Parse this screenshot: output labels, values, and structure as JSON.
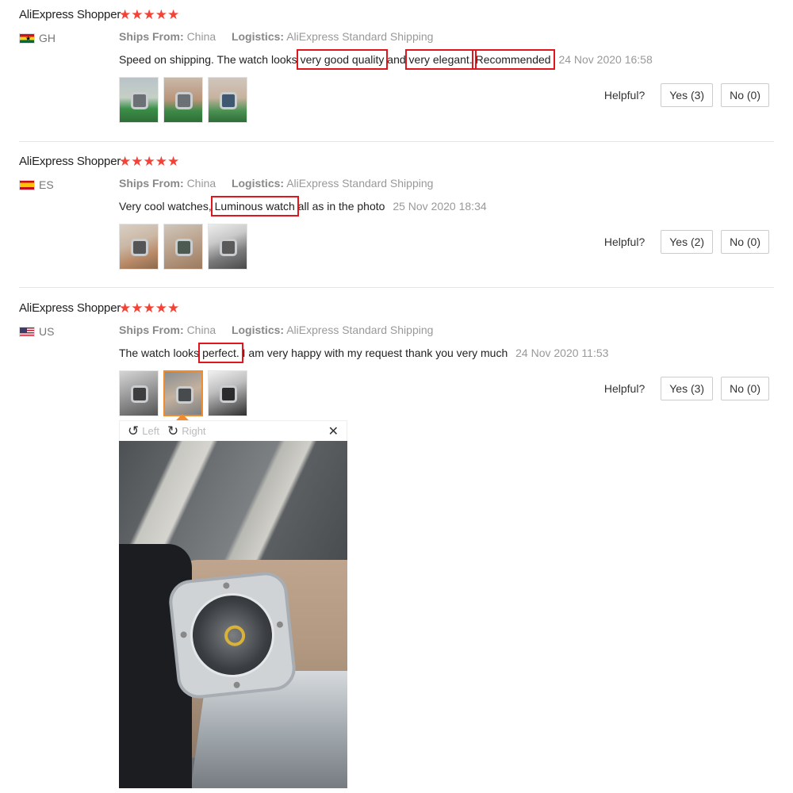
{
  "reviews": [
    {
      "name": "AliExpress Shopper",
      "stars": "★★★★★",
      "rating": 5,
      "country_code": "GH",
      "ships_from_label": "Ships From:",
      "ships_from_value": "China",
      "logistics_label": "Logistics:",
      "logistics_value": "AliExpress Standard Shipping",
      "text_parts": [
        "Speed on shipping. The watch looks ",
        "very good quality",
        " and ",
        "very elegant.",
        " ",
        "Recommended"
      ],
      "date": "24 Nov 2020 16:58",
      "thumbnail_count": 3,
      "helpful_label": "Helpful?",
      "yes_label": "Yes (3)",
      "no_label": "No (0)"
    },
    {
      "name": "AliExpress Shopper",
      "stars": "★★★★★",
      "rating": 5,
      "country_code": "ES",
      "ships_from_label": "Ships From:",
      "ships_from_value": "China",
      "logistics_label": "Logistics:",
      "logistics_value": "AliExpress Standard Shipping",
      "text_parts": [
        "Very cool watches, ",
        "Luminous watch",
        " all as in the photo"
      ],
      "date": "25 Nov 2020 18:34",
      "thumbnail_count": 3,
      "helpful_label": "Helpful?",
      "yes_label": "Yes (2)",
      "no_label": "No (0)"
    },
    {
      "name": "AliExpress Shopper",
      "stars": "★★★★★",
      "rating": 5,
      "country_code": "US",
      "ships_from_label": "Ships From:",
      "ships_from_value": "China",
      "logistics_label": "Logistics:",
      "logistics_value": "AliExpress Standard Shipping",
      "text_parts": [
        "The watch looks ",
        "perfect.",
        " I am very happy with my request thank you very much"
      ],
      "date": "24 Nov 2020 11:53",
      "thumbnail_count": 3,
      "selected_thumbnail": 2,
      "helpful_label": "Helpful?",
      "yes_label": "Yes (3)",
      "no_label": "No (0)"
    }
  ],
  "viewer": {
    "rotate_left_label": "Left",
    "rotate_right_label": "Right",
    "rotate_left_icon": "rotate-left-icon",
    "rotate_right_icon": "rotate-right-icon",
    "close_icon": "close-icon"
  },
  "colors": {
    "star": "#f44336",
    "highlight_box": "#e0161e",
    "active_thumb_border": "#f08c30"
  }
}
